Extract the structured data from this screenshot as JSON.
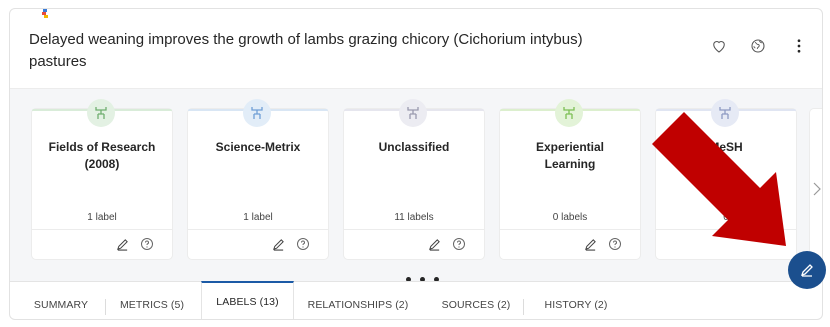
{
  "publication": {
    "title": "Delayed weaning improves the growth of lambs grazing chicory (Cichorium intybus) pastures",
    "title_line1": "Delayed weaning improves the growth of lambs grazing chicory (Cichorium intybus)",
    "title_line2": "pastures"
  },
  "header_icons": [
    "heart-icon",
    "globe-icon",
    "more-vertical-icon"
  ],
  "label_cards": [
    {
      "title": "Fields of Research (2008)",
      "title_line1": "Fields of Research",
      "title_line2": "(2008)",
      "count": "1 label",
      "accent": "#8cc78e"
    },
    {
      "title": "Science-Metrix",
      "title_line1": "Science-Metrix",
      "title_line2": "",
      "count": "1 label",
      "accent": "#8fb8e3"
    },
    {
      "title": "Unclassified",
      "title_line1": "Unclassified",
      "title_line2": "",
      "count": "11 labels",
      "accent": "#b8b8c8"
    },
    {
      "title": "Experiential Learning",
      "title_line1": "Experiential",
      "title_line2": "Learning",
      "count": "0 labels",
      "accent": "#9ed37a"
    },
    {
      "title": "MeSH",
      "title_line1": "MeSH",
      "title_line2": "",
      "count": "0",
      "accent": "#a6b3d6"
    }
  ],
  "tabs": [
    {
      "label": "SUMMARY",
      "active": false
    },
    {
      "label": "METRICS (5)",
      "active": false
    },
    {
      "label": "LABELS (13)",
      "active": true
    },
    {
      "label": "RELATIONSHIPS (2)",
      "active": false
    },
    {
      "label": "SOURCES (2)",
      "active": false
    },
    {
      "label": "HISTORY (2)",
      "active": false
    }
  ],
  "colors": {
    "accent_blue": "#1b4f8e",
    "active_tab": "#1b5aa6",
    "annotation_arrow": "#c00000"
  }
}
